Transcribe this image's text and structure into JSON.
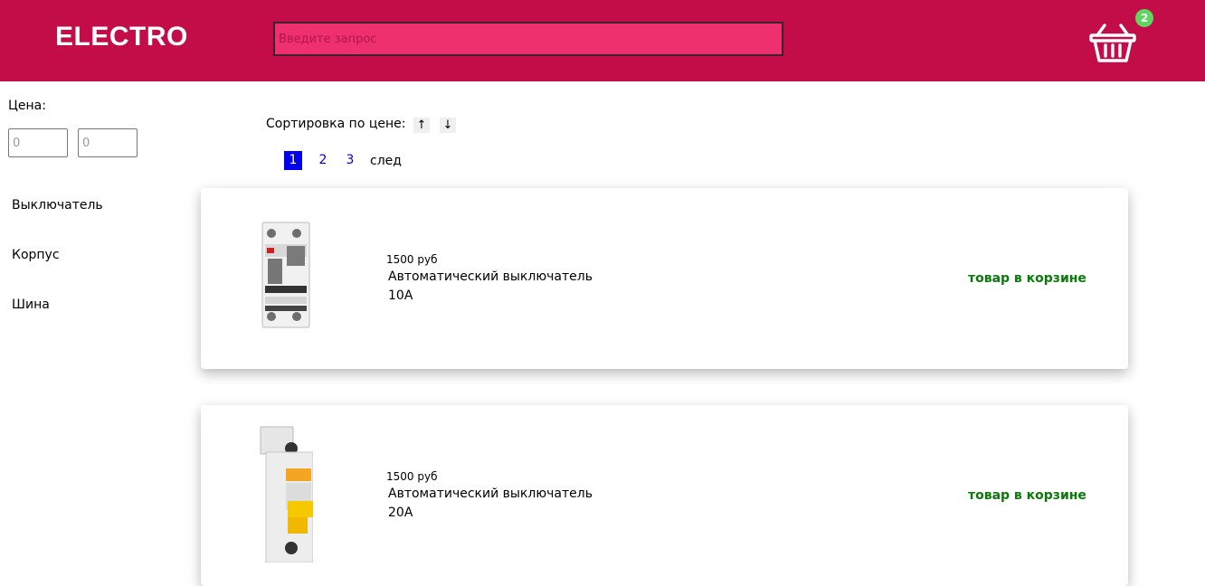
{
  "header": {
    "logo": "ELECTRO",
    "search_placeholder": "Введите запрос",
    "cart_count": "2"
  },
  "filters": {
    "price_label": "Цена:",
    "price_min_placeholder": "0",
    "price_max_placeholder": "0",
    "categories": [
      "Выключатель",
      "Корпус",
      "Шина"
    ]
  },
  "sort": {
    "label": "Сортировка по цене:",
    "asc": "↑",
    "desc": "↓"
  },
  "pagination": {
    "pages": [
      "1",
      "2",
      "3"
    ],
    "current": "1",
    "next": "след"
  },
  "products": [
    {
      "price": "1500 руб",
      "name_line1": "Автоматический выключатель",
      "name_line2": "10А",
      "status": "товар в корзине",
      "image": "differential-breaker-2-pole"
    },
    {
      "price": "1500 руб",
      "name_line1": "Автоматический выключатель",
      "name_line2": "20А",
      "status": "товар в корзине",
      "image": "circuit-breaker-1-pole"
    }
  ],
  "colors": {
    "header": "#c20d48",
    "search_bg": "#ee306e",
    "badge": "#5fd65f",
    "in_cart": "#0a7a0a",
    "active_page": "#0000ee"
  }
}
